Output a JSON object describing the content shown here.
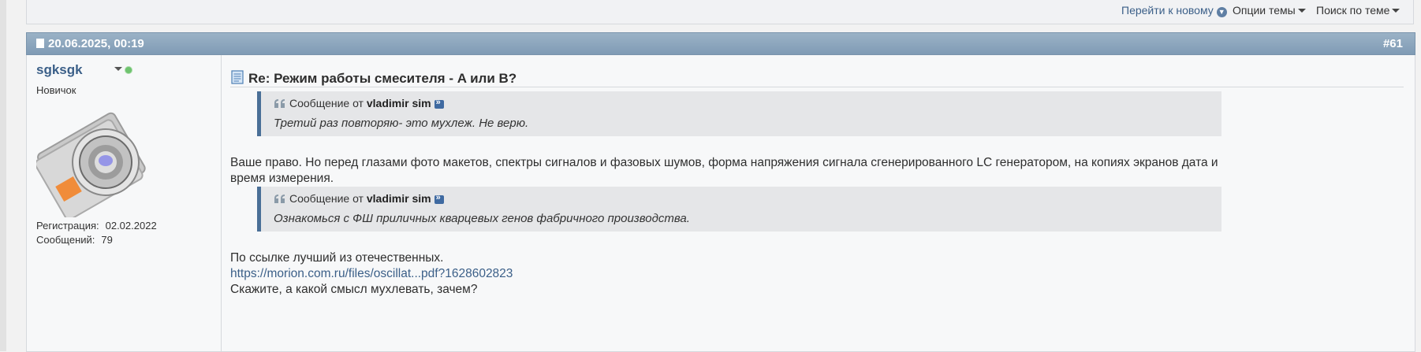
{
  "toolbar": {
    "goto_newest": "Перейти к новому",
    "thread_options": "Опции темы",
    "search_thread": "Поиск по теме"
  },
  "post": {
    "date": "20.06.2025, 00:19",
    "number": "#61",
    "user": {
      "name": "sgksgk",
      "title": "Новичок",
      "reg_label": "Регистрация:",
      "reg_value": "02.02.2022",
      "msgs_label": "Сообщений:",
      "msgs_value": "79"
    },
    "title": "Re: Режим работы смесителя - A или B?",
    "quotes": [
      {
        "prefix": "Сообщение от",
        "author": "vladimir sim",
        "text": "Третий раз повторяю- это мухлеж. Не верю."
      },
      {
        "prefix": "Сообщение от",
        "author": "vladimir sim",
        "text": "Ознакомься с ФШ приличных кварцевых генов фабричного производства."
      }
    ],
    "paragraph1": "Ваше право. Но перед глазами фото макетов, спектры сигналов и фазовых шумов, форма напряжения сигнала сгенерированного LC генератором, на копиях экранов дата и время измерения.",
    "line_before_link": "По ссылке лучший из отечественных.",
    "link": "https://morion.com.ru/files/oscillat...pdf?1628602823",
    "line_after_link": "Скажите, а какой смысл мухлевать, зачем?"
  }
}
